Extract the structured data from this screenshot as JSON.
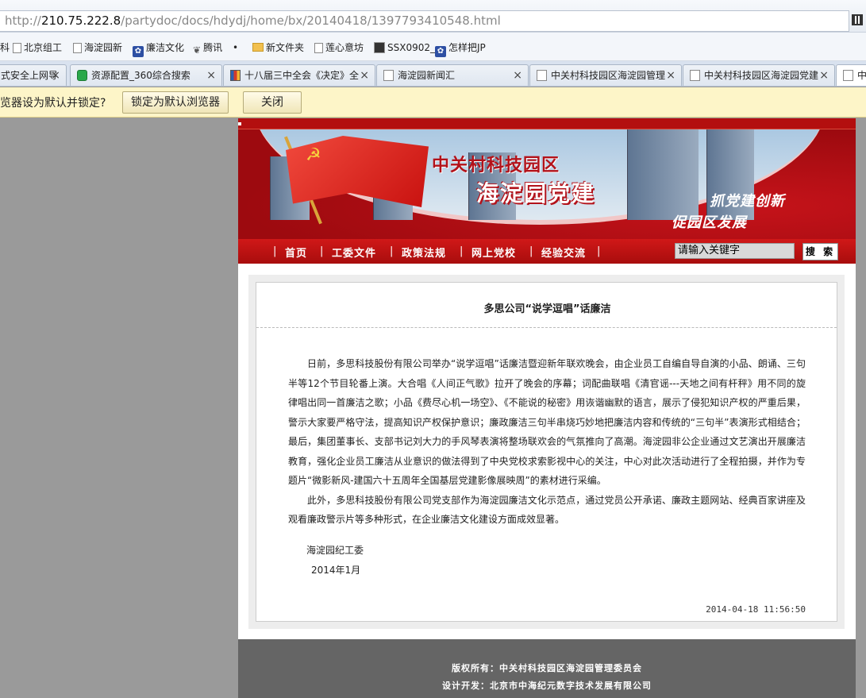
{
  "browser": {
    "address": {
      "scheme": "http://",
      "host": "210.75.222.8",
      "path": "/partydoc/docs/hdydj/home/bx/20140418/1397793410548.html"
    },
    "bookmarks": [
      {
        "label": "科",
        "icon": "none"
      },
      {
        "label": "北京组工",
        "icon": "page-icon"
      },
      {
        "label": "海淀园新",
        "icon": "page-icon"
      },
      {
        "label": "廉洁文化",
        "icon": "paw-icon"
      },
      {
        "label": "腾讯",
        "icon": "tencent-icon"
      },
      {
        "label": "•",
        "icon": "none"
      },
      {
        "label": "新文件夹",
        "icon": "folder-icon"
      },
      {
        "label": "莲心意坊",
        "icon": "page-icon"
      },
      {
        "label": "SSX0902_",
        "icon": "ssx-icon"
      },
      {
        "label": "怎样把JP",
        "icon": "paw-icon"
      }
    ],
    "tabs": [
      {
        "label": "式安全上网导",
        "icon": "page-icon"
      },
      {
        "label": "资源配置_360综合搜索",
        "icon": "search-icon"
      },
      {
        "label": "十八届三中全会《决定》全",
        "icon": "site-icon"
      },
      {
        "label": "海淀园新闻汇",
        "icon": "page-icon"
      },
      {
        "label": "中关村科技园区海淀园管理",
        "icon": "page-icon"
      },
      {
        "label": "中关村科技园区海淀园党建",
        "icon": "page-icon"
      },
      {
        "label": "中",
        "icon": "page-icon"
      }
    ],
    "notification": {
      "message": "览器设为默认并锁定?",
      "lock_button": "锁定为默认浏览器",
      "close_button": "关闭"
    }
  },
  "site": {
    "banner": {
      "title_line1": "中关村科技园区",
      "title_line2": "海淀园党建",
      "slogan_line1": "抓党建创新",
      "slogan_line2": "促园区发展"
    },
    "nav": {
      "items": [
        "首页",
        "工委文件",
        "政策法规",
        "网上党校",
        "经验交流"
      ],
      "search_value": "请输入关键字",
      "search_button": "搜 索"
    },
    "article": {
      "title": "多思公司“说学逗唱”话廉洁",
      "paragraphs": [
        "日前，多思科技股份有限公司举办“说学逗唱”话廉洁暨迎新年联欢晚会，由企业员工自编自导自演的小品、朗诵、三句半等12个节目轮番上演。大合唱《人间正气歌》拉开了晚会的序幕；词配曲联唱《清官谣---天地之间有杆秤》用不同的旋律唱出同一首廉洁之歌；小品《费尽心机一场空》、《不能说的秘密》用诙谐幽默的语言，展示了侵犯知识产权的严重后果，警示大家要严格守法，提高知识产权保护意识；廉政廉洁三句半串烧巧妙地把廉洁内容和传统的“三句半”表演形式相结合；最后，集团董事长、支部书记刘大力的手风琴表演将整场联欢会的气氛推向了高潮。海淀园非公企业通过文艺演出开展廉洁教育，强化企业员工廉洁从业意识的做法得到了中央党校求索影视中心的关注，中心对此次活动进行了全程拍摄，并作为专题片“微影新风-建国六十五周年全国基层党建影像展映周”的素材进行采编。",
        "此外，多思科技股份有限公司党支部作为海淀园廉洁文化示范点，通过党员公开承诺、廉政主题网站、经典百家讲座及观看廉政警示片等多种形式，在企业廉洁文化建设方面成效显著。"
      ],
      "signature": "海淀园纪工委",
      "date": "2014年1月",
      "timestamp": "2014-04-18 11:56:50"
    },
    "footer": {
      "copyright": "版权所有：中关村科技园区海淀园管理委员会",
      "designer": "设计开发：北京市中海纪元数字技术发展有限公司"
    }
  },
  "colors": {
    "party_red": "#b30f0f",
    "nav_red": "#c41414",
    "footer_gray": "#656565",
    "notification_yellow": "#fdf5c8"
  }
}
